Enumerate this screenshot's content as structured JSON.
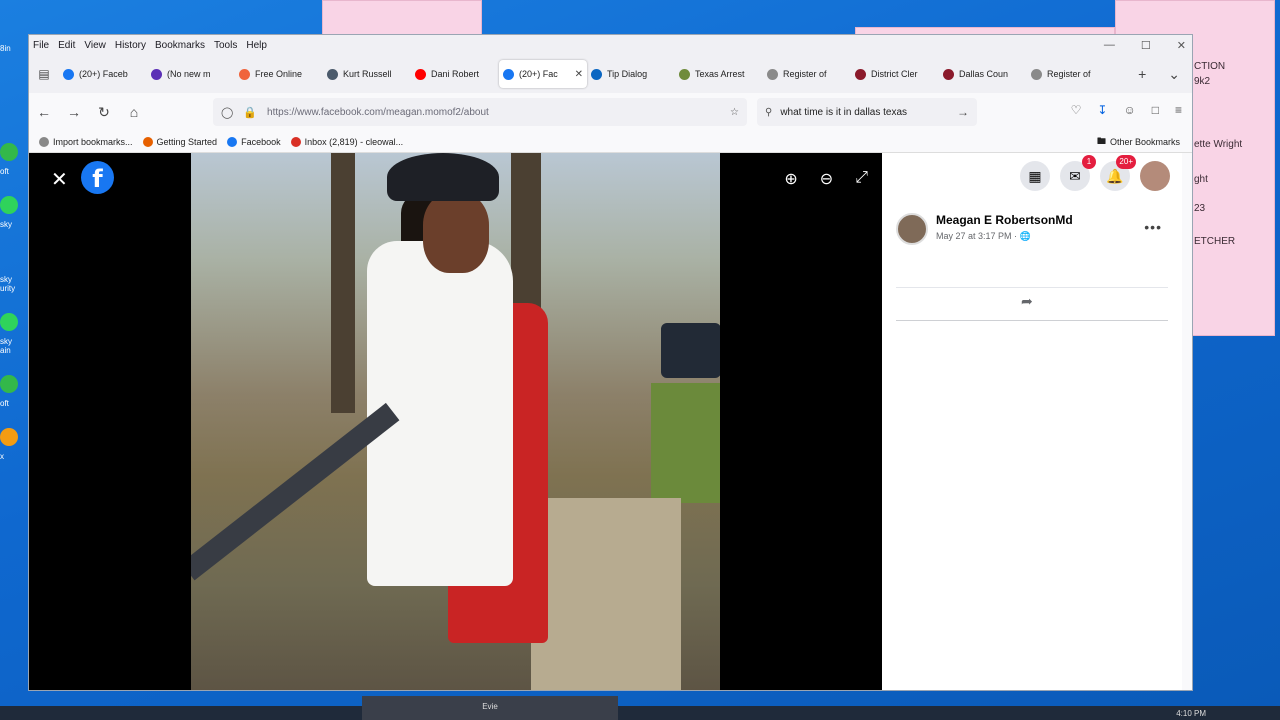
{
  "desktop": {
    "note_lines": [
      "CTION",
      "9k2",
      "ette Wright",
      "ght",
      "23",
      "ETCHER"
    ],
    "icon_labels": [
      "8in",
      "oft",
      "sky",
      "sky urity",
      "sky ain",
      "oft",
      "x"
    ],
    "taskbar_center_label": "Evie",
    "taskbar_time": "4:10 PM"
  },
  "browser": {
    "menu": [
      "File",
      "Edit",
      "View",
      "History",
      "Bookmarks",
      "Tools",
      "Help"
    ],
    "tabs": [
      {
        "label": "(20+) Faceb",
        "icon_color": "#1877f2",
        "active": false
      },
      {
        "label": "(No new m",
        "icon_color": "#5b2fb6",
        "active": false
      },
      {
        "label": "Free Online",
        "icon_color": "#f0643c",
        "active": false
      },
      {
        "label": "Kurt Russell",
        "icon_color": "#4b5a6b",
        "active": false
      },
      {
        "label": "Dani Robert",
        "icon_color": "#ff0000",
        "active": false
      },
      {
        "label": "(20+) Fac",
        "icon_color": "#1877f2",
        "active": true
      },
      {
        "label": "Tip Dialog",
        "icon_color": "#0a66c2",
        "active": false
      },
      {
        "label": "Texas Arrest",
        "icon_color": "#6f8b3b",
        "active": false
      },
      {
        "label": "Register of",
        "icon_color": "#8a8a8a",
        "active": false
      },
      {
        "label": "District Cler",
        "icon_color": "#8b1a2b",
        "active": false
      },
      {
        "label": "Dallas Coun",
        "icon_color": "#8b1a2b",
        "active": false
      },
      {
        "label": "Register of",
        "icon_color": "#8a8a8a",
        "active": false
      }
    ],
    "url": "https://www.facebook.com/meagan.momof2/about",
    "search_query": "what time is it in dallas texas",
    "bookmarks": [
      {
        "label": "Import bookmarks...",
        "color": "#888"
      },
      {
        "label": "Getting Started",
        "color": "#e66000"
      },
      {
        "label": "Facebook",
        "color": "#1877f2"
      },
      {
        "label": "Inbox (2,819) - cleowal...",
        "color": "#d93025"
      }
    ],
    "other_bookmarks": "Other Bookmarks"
  },
  "post": {
    "author": "Meagan E RobertsonMd",
    "timestamp": "May 27 at 3:17 PM · 🌐"
  },
  "header": {
    "messenger_badge": "1",
    "notifications_badge": "20+"
  }
}
